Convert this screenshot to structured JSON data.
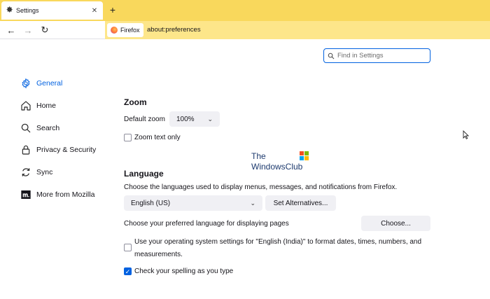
{
  "tab": {
    "title": "Settings",
    "close_label": "✕"
  },
  "new_tab_label": "+",
  "nav": {
    "back": "←",
    "forward": "→",
    "reload": "↻"
  },
  "identity": {
    "label": "Firefox"
  },
  "url": "about:preferences",
  "search": {
    "placeholder": "Find in Settings",
    "value": ""
  },
  "sidebar": {
    "items": [
      {
        "label": "General",
        "icon": "gear-icon",
        "selected": true
      },
      {
        "label": "Home",
        "icon": "home-icon"
      },
      {
        "label": "Search",
        "icon": "search-icon"
      },
      {
        "label": "Privacy & Security",
        "icon": "lock-icon"
      },
      {
        "label": "Sync",
        "icon": "sync-icon"
      },
      {
        "label": "More from Mozilla",
        "icon": "mozilla-icon"
      }
    ]
  },
  "zoom": {
    "heading": "Zoom",
    "default_label": "Default zoom",
    "default_value": "100%",
    "text_only_label": "Zoom text only",
    "text_only_checked": false
  },
  "language": {
    "heading": "Language",
    "description": "Choose the languages used to display menus, messages, and notifications from Firefox.",
    "selected": "English (US)",
    "set_alternatives_label": "Set Alternatives...",
    "pages_label": "Choose your preferred language for displaying pages",
    "choose_label": "Choose...",
    "os_settings_label_line1": "Use your operating system settings for \"English (India)\" to format dates, times, numbers, and",
    "os_settings_label_line2": "measurements.",
    "os_settings_checked": false,
    "spellcheck_label": "Check your spelling as you type",
    "spellcheck_checked": true
  },
  "watermark": {
    "line1": "The",
    "line2": "WindowsClub"
  },
  "colors": {
    "accent": "#0061e0",
    "tabstrip": "#f9d85c",
    "urlbar": "#fde68a",
    "button": "#f0f0f4"
  }
}
